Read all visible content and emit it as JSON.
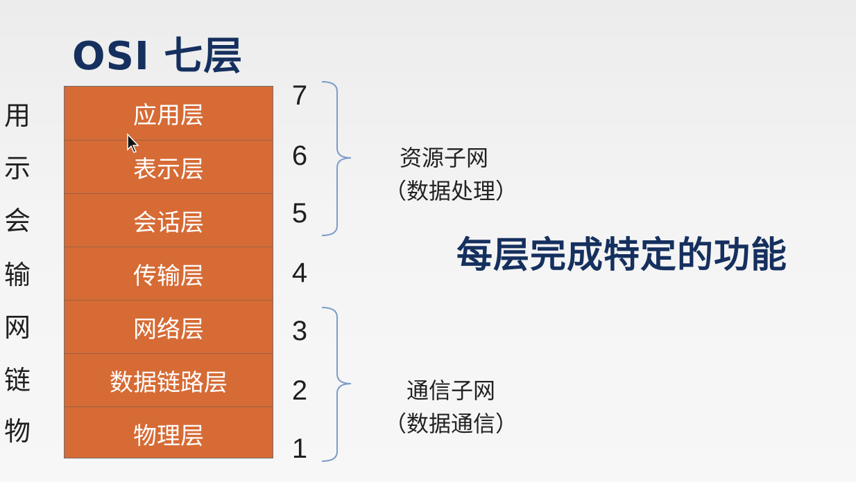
{
  "title": "OSI  七层",
  "headline": "每层完成特定的功能",
  "layers": [
    {
      "name": "应用层",
      "number": "7",
      "abbr": "用"
    },
    {
      "name": "表示层",
      "number": "6",
      "abbr": "示"
    },
    {
      "name": "会话层",
      "number": "5",
      "abbr": "会"
    },
    {
      "name": "传输层",
      "number": "4",
      "abbr": "输"
    },
    {
      "name": "网络层",
      "number": "3",
      "abbr": "网"
    },
    {
      "name": "数据链路层",
      "number": "2",
      "abbr": "链"
    },
    {
      "name": "物理层",
      "number": "1",
      "abbr": "物"
    }
  ],
  "groups": [
    {
      "name": "资源子网",
      "desc": "（数据处理）"
    },
    {
      "name": "通信子网",
      "desc": "（数据通信）"
    }
  ],
  "colors": {
    "layer_fill": "#d66b35",
    "title": "#15305e",
    "brace": "#7b9cc8"
  }
}
